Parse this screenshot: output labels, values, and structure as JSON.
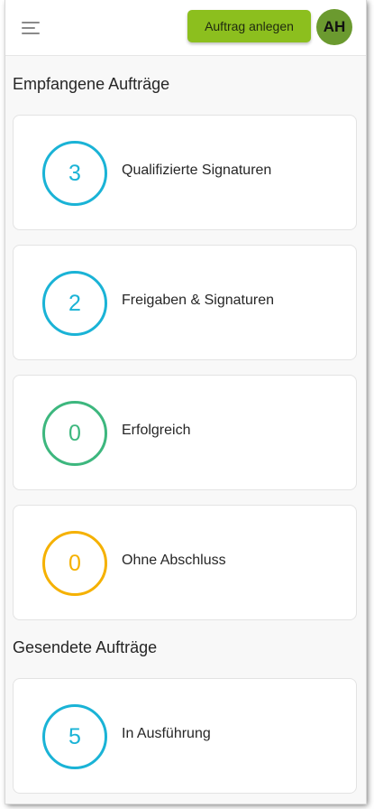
{
  "header": {
    "menu_icon": "hamburger-menu-icon",
    "create_button_label": "Auftrag anlegen",
    "avatar_initials": "AH"
  },
  "colors": {
    "brand_green": "#8cbf1e",
    "avatar_green": "#6b9a2f",
    "ring_blue": "#1ab3d6",
    "ring_green": "#3db77e",
    "ring_orange": "#f5b100"
  },
  "received": {
    "title": "Empfangene Aufträge",
    "items": [
      {
        "count": "3",
        "label": "Qualifizierte Signaturen",
        "color": "#1ab3d6"
      },
      {
        "count": "2",
        "label": "Freigaben & Signaturen",
        "color": "#1ab3d6"
      },
      {
        "count": "0",
        "label": "Erfolgreich",
        "color": "#3db77e"
      },
      {
        "count": "0",
        "label": "Ohne Abschluss",
        "color": "#f5b100"
      }
    ]
  },
  "sent": {
    "title": "Gesendete Aufträge",
    "items": [
      {
        "count": "5",
        "label": "In Ausführung",
        "color": "#1ab3d6"
      }
    ]
  }
}
